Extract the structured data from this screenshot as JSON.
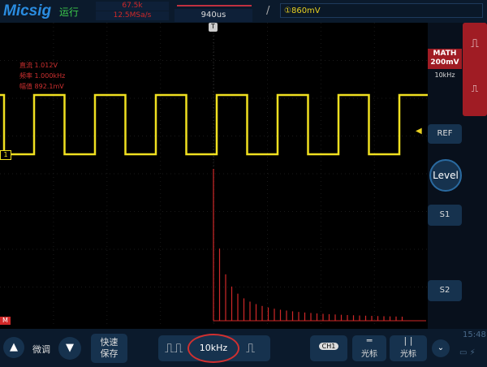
{
  "header": {
    "logo": "Micsig",
    "status": "运行",
    "memory_depth": "67.5k",
    "sample_rate": "12.5MSa/s",
    "timebase": "940us",
    "trigger_level": "①860mV"
  },
  "measurements": [
    {
      "label": "直流",
      "value": "1.012V"
    },
    {
      "label": "频率",
      "value": "1.000kHz"
    },
    {
      "label": "幅值",
      "value": "892.1mV"
    }
  ],
  "markers": {
    "ch1": "1",
    "math": "M",
    "trigger_pos": "T"
  },
  "right_panel": {
    "math_label": "MATH",
    "math_scale": "200mV",
    "math_freq": "10kHz",
    "ref": "REF",
    "level": "Level",
    "s1": "S1",
    "s2": "S2"
  },
  "bottom": {
    "fine_adjust": "微调",
    "quick_save_1": "快速",
    "quick_save_2": "保存",
    "freq_value": "10kHz",
    "ch1": "CH1",
    "cursor_h": "光标",
    "cursor_v": "光标",
    "time": "15:48"
  },
  "colors": {
    "ch1": "#f0e020",
    "math": "#d02828",
    "accent": "#2a8ce0"
  },
  "waveform": {
    "type": "square",
    "ch1_frequency": "1.000kHz"
  }
}
